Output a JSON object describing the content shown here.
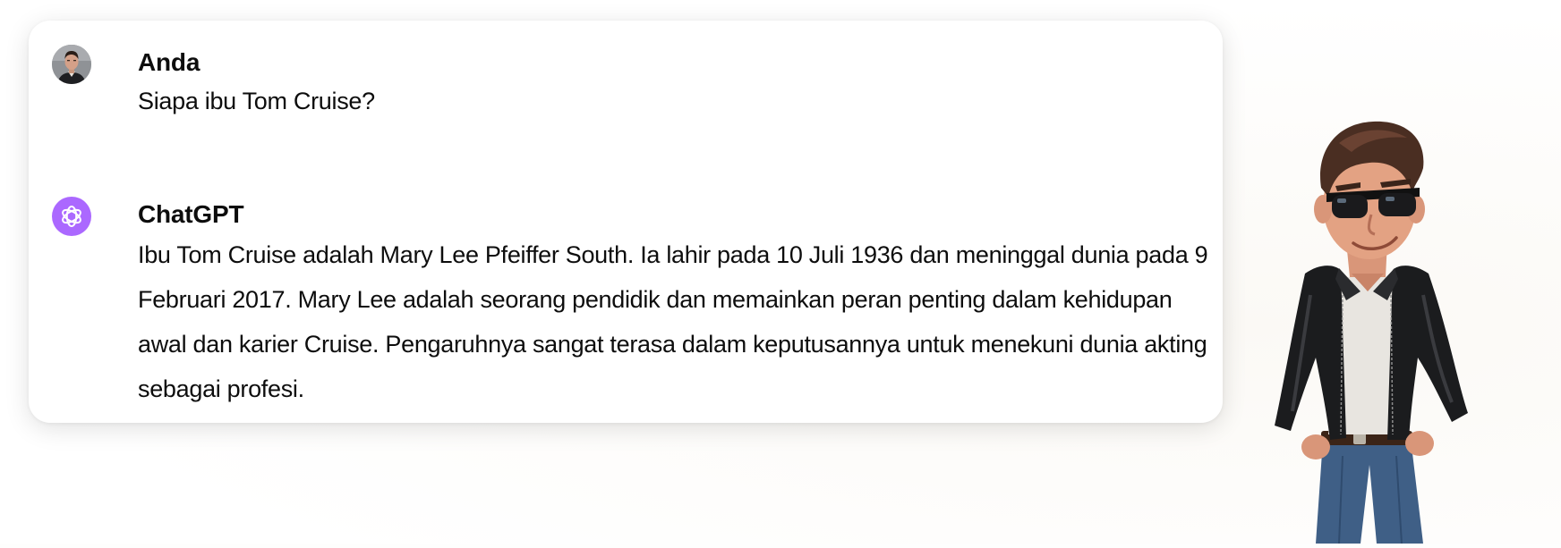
{
  "conversation": {
    "user": {
      "name": "Anda",
      "message": "Siapa ibu Tom Cruise?"
    },
    "assistant": {
      "name": "ChatGPT",
      "message": "Ibu Tom Cruise adalah Mary Lee Pfeiffer South. Ia lahir pada 10 Juli 1936 dan meninggal dunia pada 9 Februari 2017. Mary Lee adalah seorang pendidik dan memainkan peran penting dalam kehidupan awal dan karier Cruise. Pengaruhnya sangat terasa dalam keputusannya untuk menekuni dunia akting sebagai profesi."
    }
  },
  "icons": {
    "user_avatar": "user-avatar-photo",
    "assistant_avatar": "openai-logo-icon",
    "illustration": "cartoon-man-sunglasses-leather-jacket"
  },
  "colors": {
    "assistant_avatar_bg": "#ab68ff",
    "card_bg": "#ffffff",
    "text": "#0d0d0d"
  }
}
